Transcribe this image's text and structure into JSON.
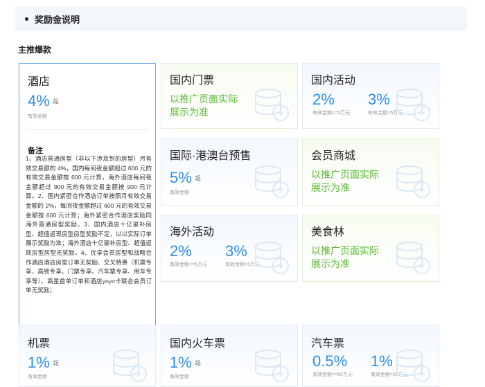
{
  "section": {
    "title": "奖励金说明"
  },
  "subtitle": "主推爆款",
  "hotel": {
    "name": "酒店",
    "rate": "4%",
    "qi": "起",
    "caption": "有效金额",
    "notes_title": "备注",
    "notes": "1、酒店普通房型（非以下涉及到的房型）月有效交易额的 4%，国内每间夜金额超过 600 元的有效交易金额按 600 元计算，海外酒店每间夜金额超过 900 元的有效交易金额按 900 元计算。2、国内紧密合作酒店订单按照月有效交易金额的 2%，每间夜金额超过 600 元的有效交易金额按 600 元计算；海外紧密合作酒店奖励同海外普通房型奖励。3、国内酒店十亿豪补房型、超值返现房型房型奖励不定，以以实际订单展示奖励为准；海外酒店十亿豪补房型、超值返现房型房型无奖励。4、优享会员房型和战略合作酒店酒店房型订单无奖励、交叉特惠（机票专享、高铁专享、门票专享、汽车票专享、用车专享等）、高星首单订单和酒店yoyo卡联合会员订单无奖励；"
  },
  "cards": {
    "domestic_tickets": {
      "name": "国内门票",
      "promo": "以推广页面实际展示为准"
    },
    "domestic_activities": {
      "name": "国内活动",
      "rate1": "2%",
      "cap1": "有效金额<=5万元",
      "rate2": "3%",
      "cap2": "有效金额>5万元"
    },
    "intl_presale": {
      "name": "国际·港澳台预售",
      "rate": "5%",
      "qi": "起",
      "caption": "有效金额"
    },
    "member_mall": {
      "name": "会员商城",
      "promo": "以推广页面实际展示为准"
    },
    "overseas_activities": {
      "name": "海外活动",
      "rate1": "2%",
      "cap1": "有效金额<=5万元",
      "rate2": "3%",
      "cap2": "有效金额>5万元"
    },
    "food_forest": {
      "name": "美食林",
      "promo": "以推广页面实际展示为准"
    },
    "flights": {
      "name": "机票",
      "rate": "1%",
      "qi": "起",
      "caption": "有效金额"
    },
    "trains": {
      "name": "国内火车票",
      "rate": "1%",
      "qi": "起",
      "caption": "有效金额"
    },
    "bus": {
      "name": "汽车票",
      "rate1": "0.5%",
      "cap1": "有效金额<=50万元",
      "rate2": "1%",
      "cap2": "有效金额>50万元"
    }
  },
  "colors": {
    "blue": "#2e8ee6",
    "green": "#5cb833",
    "selected_border": "#62a7ec"
  }
}
